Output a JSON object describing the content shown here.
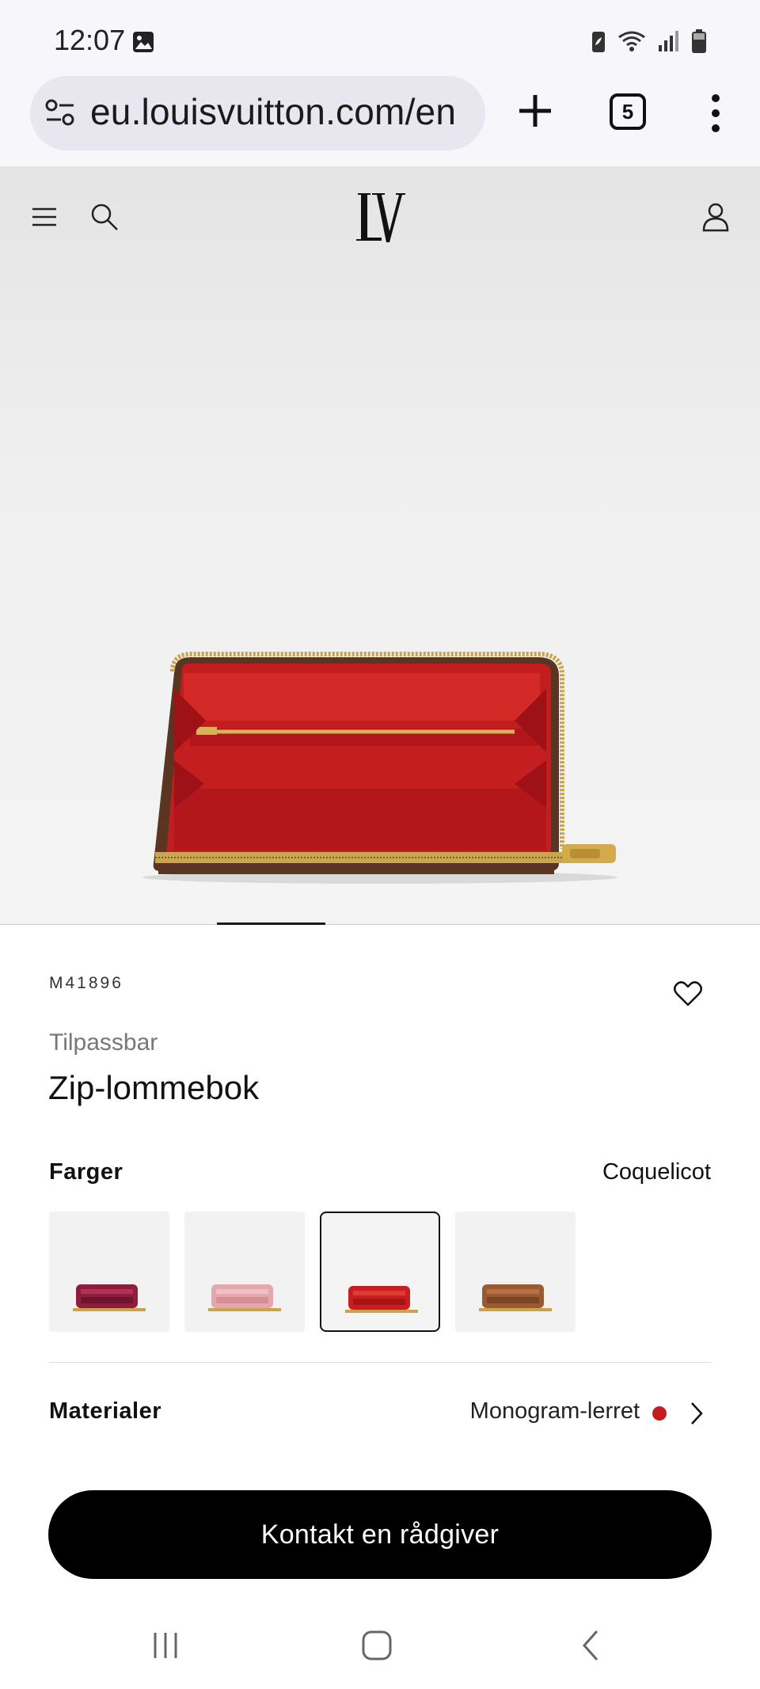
{
  "status_bar": {
    "time": "12:07",
    "icons": [
      "gallery-icon",
      "battery-saver-icon",
      "wifi-icon",
      "signal-icon",
      "battery-icon"
    ]
  },
  "browser": {
    "url": "eu.louisvuitton.com/en",
    "tab_count": "5",
    "icons": [
      "site-settings-icon",
      "plus-icon",
      "tabs-icon",
      "more-vertical-icon"
    ]
  },
  "site_header": {
    "brand": "LV",
    "icons": [
      "menu-icon",
      "search-icon",
      "account-icon"
    ]
  },
  "product": {
    "sku": "M41896",
    "customizable_label": "Tilpassbar",
    "title": "Zip-lommebok",
    "image_gallery_position": 1,
    "colors": {
      "heading": "Farger",
      "selected": "Coquelicot",
      "swatches": [
        {
          "color": "#8e1e3c"
        },
        {
          "color": "#e3a7ac"
        },
        {
          "color": "#c91d1f"
        },
        {
          "color": "#9a5a32"
        }
      ],
      "selected_index": 2
    },
    "materials": {
      "heading": "Materialer",
      "value": "Monogram-lerret",
      "dot_color": "#c41c1c"
    },
    "cta_label": "Kontakt en rådgiver"
  },
  "system_nav": {
    "icons": [
      "recents-icon",
      "home-icon",
      "back-icon"
    ]
  }
}
